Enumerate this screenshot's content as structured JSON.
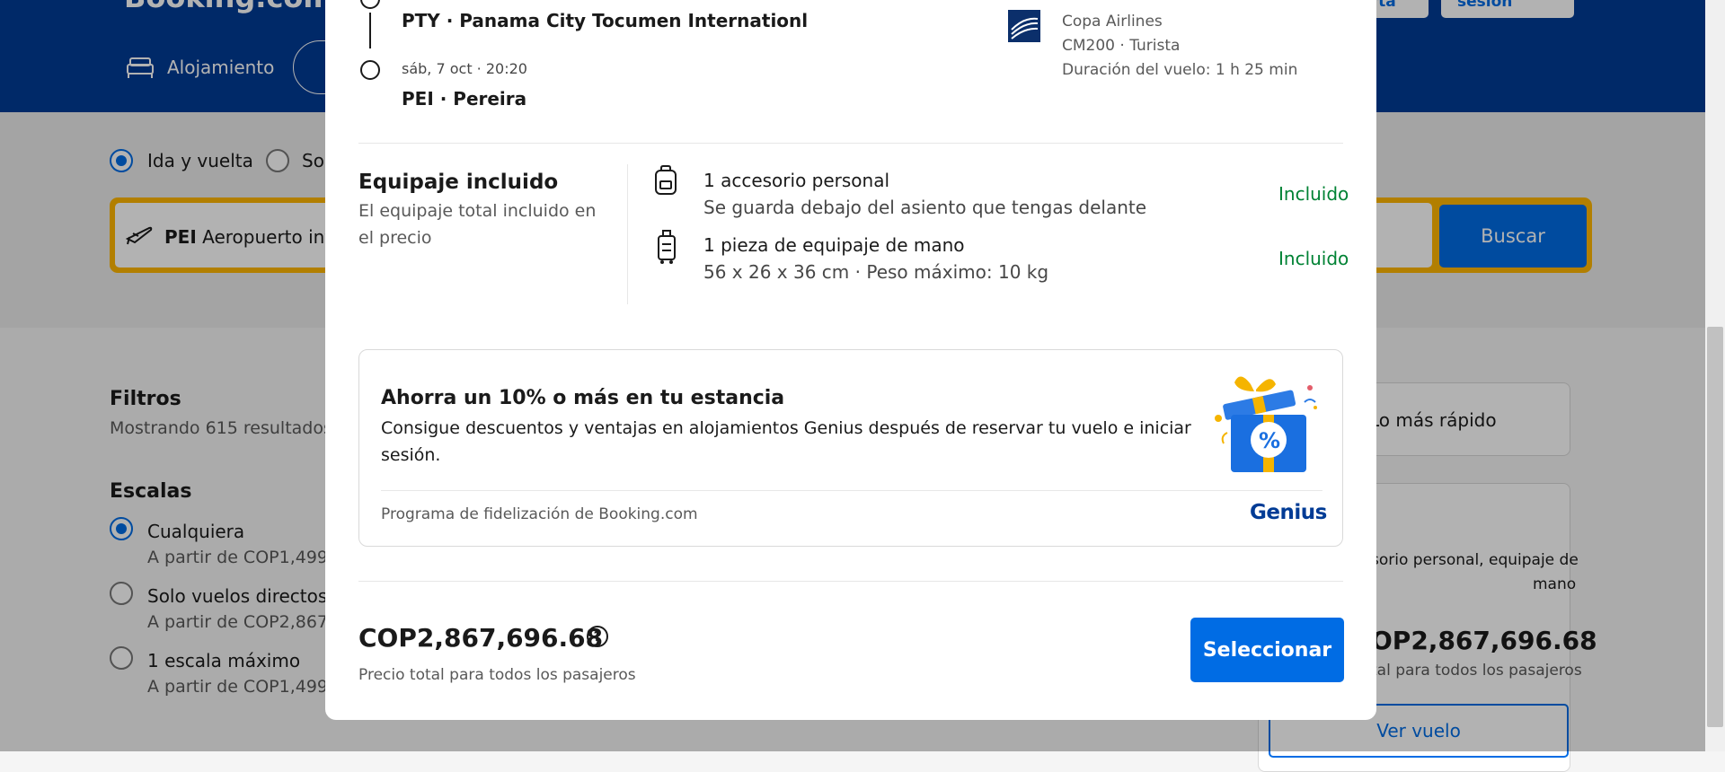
{
  "background": {
    "logo": "Booking.com",
    "header_buttons": [
      "erta",
      "Inicia sesión"
    ],
    "nav": {
      "stays": "Alojamiento"
    },
    "trip_type": {
      "round_trip": "Ida y vuelta",
      "one_way": "Sol"
    },
    "search": {
      "origin_code": "PEI",
      "origin_text": "Aeropuerto inte",
      "button": "Buscar"
    },
    "filters": {
      "title": "Filtros",
      "results": "Mostrando 615 resultados",
      "stops_title": "Escalas",
      "options": [
        {
          "label": "Cualquiera",
          "price": "A partir de COP1,499,",
          "selected": true
        },
        {
          "label": "Solo vuelos directos",
          "price": "A partir de COP2,867,",
          "selected": false
        },
        {
          "label": "1 escala máximo",
          "price": "A partir de COP1,499,",
          "selected": false
        }
      ]
    },
    "sort": {
      "fastest": "Lo más rápido"
    },
    "result_card": {
      "baggage_line1": "sorio personal, equipaje de",
      "baggage_line2": "mano",
      "price": "OP2,867,696.68",
      "price_note": "tal para todos los pasajeros",
      "button": "Ver vuelo"
    }
  },
  "modal": {
    "itinerary": {
      "departure_airport": "PTY · Panama City Tocumen Internationl",
      "arrival_time": "sáb, 7 oct · 20:20",
      "arrival_airport": "PEI · Pereira",
      "airline": "Copa Airlines",
      "flight": "CM200 · Turista",
      "duration": "Duración del vuelo: 1 h 25 min"
    },
    "baggage": {
      "title": "Equipaje incluido",
      "subtitle_line1": "El equipaje total incluido en",
      "subtitle_line2": "el precio",
      "items": [
        {
          "icon": "personal-item-bag",
          "name": "1 accesorio personal",
          "detail": "Se guarda debajo del asiento que tengas delante",
          "status": "Incluido"
        },
        {
          "icon": "carry-on-suitcase",
          "name": "1 pieza de equipaje de mano",
          "detail": "56 x 26 x 36 cm · Peso máximo: 10 kg",
          "status": "Incluido"
        }
      ]
    },
    "genius": {
      "title": "Ahorra un 10% o más en tu estancia",
      "body_line1": "Consigue descuentos y ventajas en alojamientos Genius después de reservar tu vuelo e iniciar",
      "body_line2": "sesión.",
      "footer": "Programa de fidelización de Booking.com",
      "brand": "Genius",
      "badge": "%"
    },
    "price": {
      "amount": "COP2,867,696.68",
      "note": "Precio total para todos los pasajeros",
      "help": "?"
    },
    "select_button": "Seleccionar"
  },
  "colors": {
    "brand_blue": "#003b95",
    "action_blue": "#006ce4",
    "included_green": "#008234",
    "search_yellow": "#ffb700"
  }
}
